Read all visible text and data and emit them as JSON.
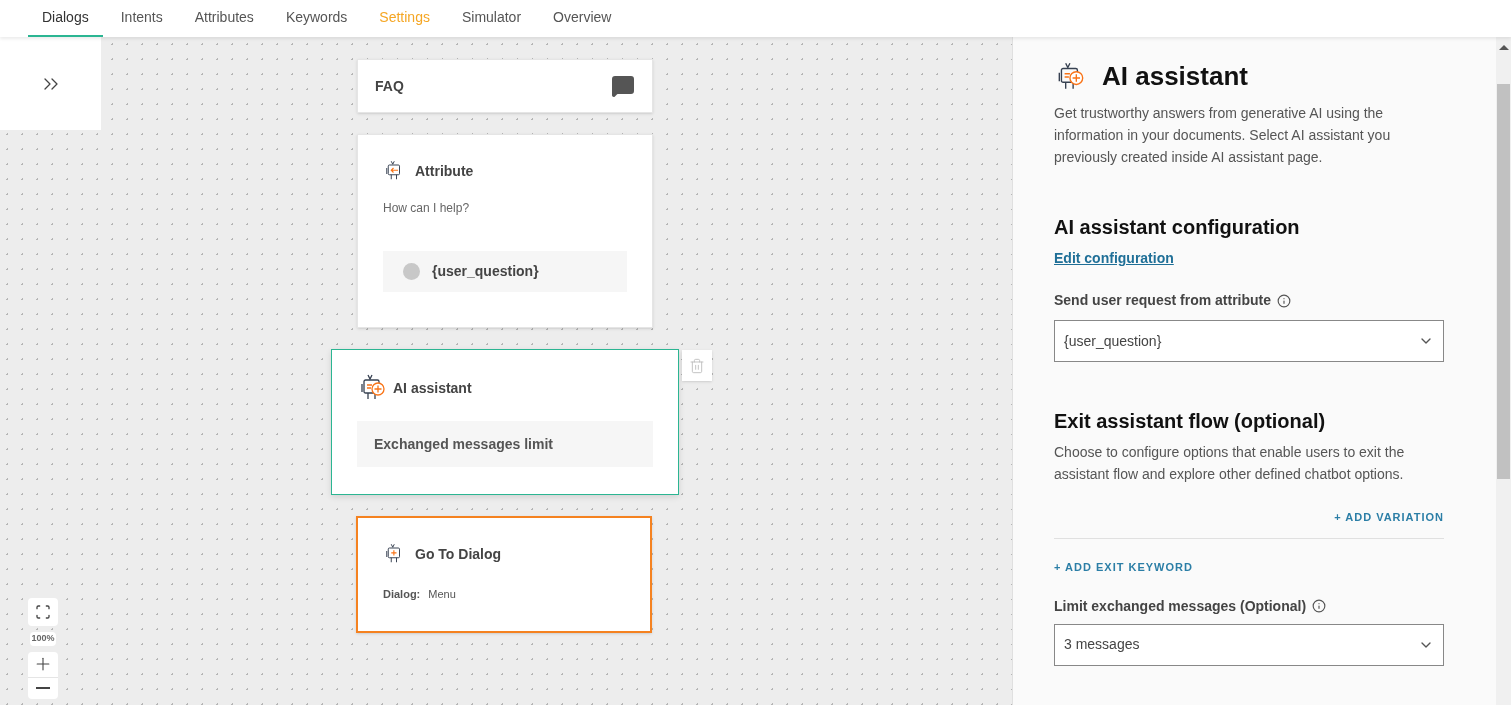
{
  "tabs": [
    {
      "label": "Dialogs",
      "selected": true,
      "warning": false
    },
    {
      "label": "Intents",
      "selected": false,
      "warning": false
    },
    {
      "label": "Attributes",
      "selected": false,
      "warning": false
    },
    {
      "label": "Keywords",
      "selected": false,
      "warning": false
    },
    {
      "label": "Settings",
      "selected": false,
      "warning": true
    },
    {
      "label": "Simulator",
      "selected": false,
      "warning": false
    },
    {
      "label": "Overview",
      "selected": false,
      "warning": false
    }
  ],
  "canvas": {
    "zoom": "100%",
    "nodes": [
      {
        "kind": "faq",
        "title": "FAQ",
        "selected": false,
        "warning": false
      },
      {
        "kind": "attribute",
        "title": "Attribute",
        "message": "How can I help?",
        "attribute": "{user_question}",
        "selected": false,
        "warning": false
      },
      {
        "kind": "ai_assistant",
        "title": "AI assistant",
        "item": "Exchanged messages limit",
        "selected": true,
        "warning": false
      },
      {
        "kind": "go_to_dialog",
        "title": "Go To Dialog",
        "field_label": "Dialog:",
        "field_value": "Menu",
        "selected": false,
        "warning": true
      }
    ]
  },
  "panel": {
    "title": "AI assistant",
    "description": "Get trustworthy answers from generative AI using the information in your documents. Select AI assistant you previously created inside AI assistant page.",
    "config_heading": "AI assistant configuration",
    "config_link": "Edit configuration",
    "attribute_label": "Send user request from attribute",
    "attribute_value": "{user_question}",
    "exit_heading": "Exit assistant flow (optional)",
    "exit_description": "Choose to configure options that enable users to exit the assistant flow and explore other defined chatbot options.",
    "add_variation": "+ ADD VARIATION",
    "add_exit_keyword": "+ ADD EXIT KEYWORD",
    "limit_label": "Limit exchanged messages (Optional)",
    "limit_value": "3 messages"
  }
}
